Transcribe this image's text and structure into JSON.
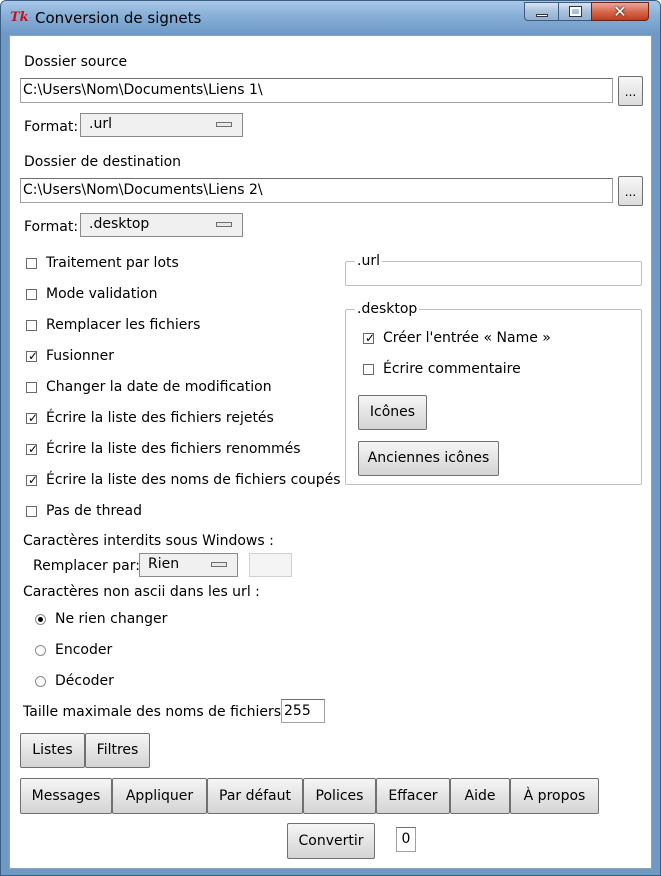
{
  "window": {
    "title": "Conversion de signets",
    "app_icon": "Tk",
    "accent": "#6f9ac4"
  },
  "source": {
    "label": "Dossier source",
    "path": "C:\\Users\\Nom\\Documents\\Liens 1\\",
    "browse_label": "...",
    "format_label": "Format:",
    "format_value": ".url"
  },
  "destination": {
    "label": "Dossier de destination",
    "path": "C:\\Users\\Nom\\Documents\\Liens 2\\",
    "browse_label": "...",
    "format_label": "Format:",
    "format_value": ".desktop"
  },
  "options": [
    {
      "label": "Traitement par lots",
      "checked": false
    },
    {
      "label": "Mode validation",
      "checked": false
    },
    {
      "label": "Remplacer les fichiers",
      "checked": false
    },
    {
      "label": "Fusionner",
      "checked": true
    },
    {
      "label": "Changer la date de modification",
      "checked": false
    },
    {
      "label": "Écrire la liste des fichiers rejetés",
      "checked": true
    },
    {
      "label": "Écrire la liste des fichiers renommés",
      "checked": true
    },
    {
      "label": "Écrire la liste des noms de fichiers coupés",
      "checked": true
    },
    {
      "label": "Pas de thread",
      "checked": false
    }
  ],
  "url_frame": {
    "title": ".url"
  },
  "desktop_frame": {
    "title": ".desktop",
    "options": [
      {
        "label": "Créer l'entrée « Name »",
        "checked": true
      },
      {
        "label": "Écrire commentaire",
        "checked": false
      }
    ],
    "icons_button": "Icônes",
    "old_icons_button": "Anciennes icônes"
  },
  "forbidden": {
    "label": "Caractères interdits sous Windows :",
    "replace_label": "Remplacer par:",
    "replace_value": "Rien",
    "custom_value": ""
  },
  "nonascii": {
    "label": "Caractères non ascii dans les url :",
    "options": [
      {
        "label": "Ne rien changer",
        "selected": true
      },
      {
        "label": "Encoder",
        "selected": false
      },
      {
        "label": "Décoder",
        "selected": false
      }
    ]
  },
  "max_length": {
    "label": "Taille maximale des noms de fichiers :",
    "value": "255"
  },
  "buttons_row1": [
    "Listes",
    "Filtres"
  ],
  "buttons_row2": [
    "Messages",
    "Appliquer",
    "Par défaut",
    "Polices",
    "Effacer",
    "Aide",
    "À propos"
  ],
  "convert": {
    "label": "Convertir",
    "count": "0"
  }
}
